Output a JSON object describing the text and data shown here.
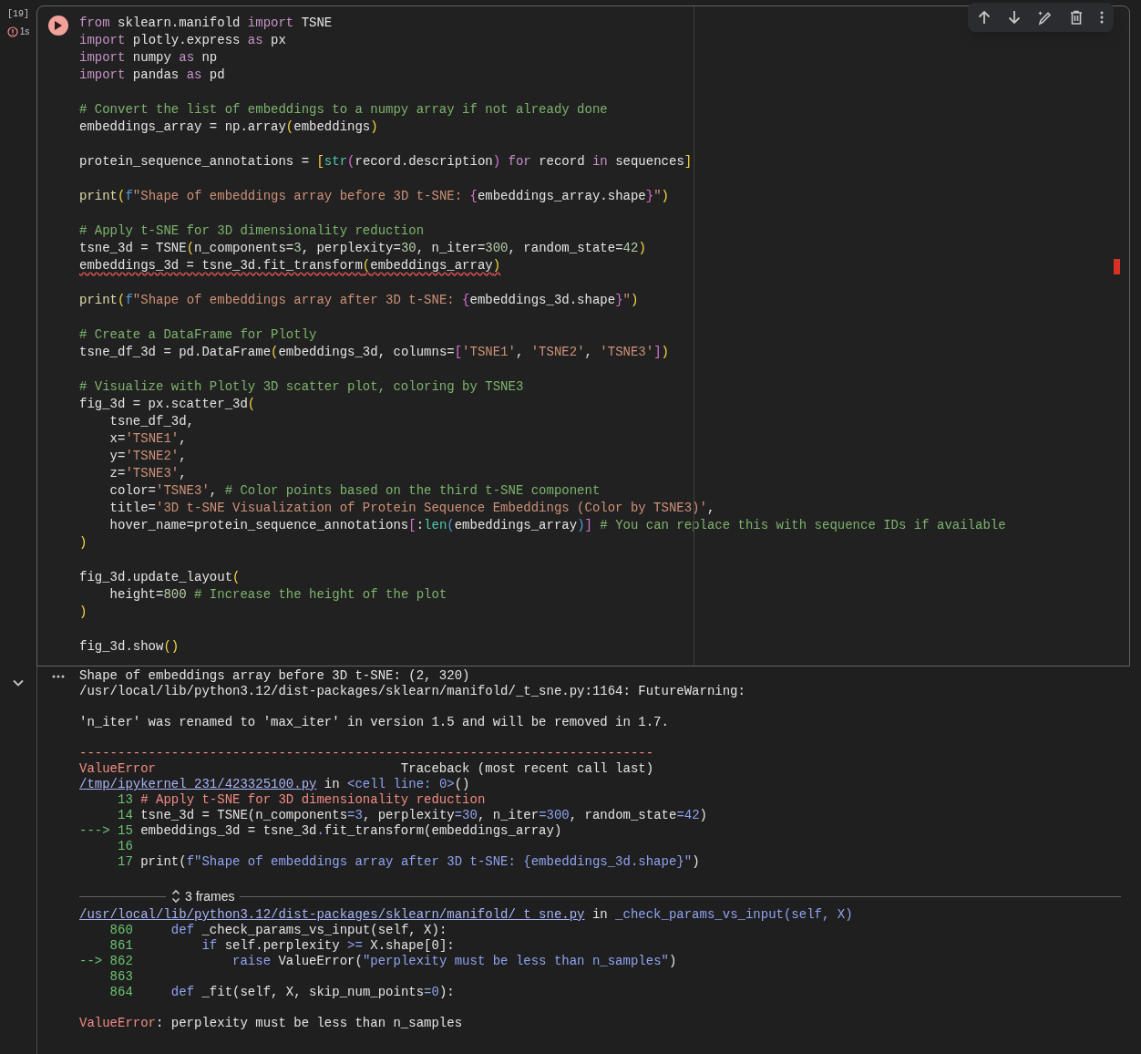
{
  "cell": {
    "execution_count": "[19]",
    "duration": "1s",
    "has_error": true,
    "selected": true
  },
  "code_blocks": [
    [
      {
        "tokens": [
          {
            "kind": "keyword",
            "text": "from"
          },
          {
            "kind": "plain",
            "text": " sklearn.manifold "
          },
          {
            "kind": "keyword",
            "text": "import"
          },
          {
            "kind": "plain",
            "text": " TSNE"
          }
        ]
      },
      {
        "tokens": [
          {
            "kind": "keyword",
            "text": "import"
          },
          {
            "kind": "plain",
            "text": " plotly.express "
          },
          {
            "kind": "keyword",
            "text": "as"
          },
          {
            "kind": "plain",
            "text": " px"
          }
        ]
      },
      {
        "tokens": [
          {
            "kind": "keyword",
            "text": "import"
          },
          {
            "kind": "plain",
            "text": " numpy "
          },
          {
            "kind": "keyword",
            "text": "as"
          },
          {
            "kind": "plain",
            "text": " np"
          }
        ]
      },
      {
        "tokens": [
          {
            "kind": "keyword",
            "text": "import"
          },
          {
            "kind": "plain",
            "text": " pandas "
          },
          {
            "kind": "keyword",
            "text": "as"
          },
          {
            "kind": "plain",
            "text": " pd"
          }
        ]
      }
    ],
    [
      {
        "tokens": [
          {
            "kind": "comment",
            "text": "# Convert the list of embeddings to a numpy array if not already done"
          }
        ]
      },
      {
        "tokens": [
          {
            "kind": "plain",
            "text": "embeddings_array = np.array"
          },
          {
            "kind": "bracket",
            "text": "("
          },
          {
            "kind": "plain",
            "text": "embeddings"
          },
          {
            "kind": "bracket",
            "text": ")"
          }
        ]
      }
    ],
    [
      {
        "tokens": [
          {
            "kind": "plain",
            "text": "protein_sequence_annotations = "
          },
          {
            "kind": "bracket",
            "text": "["
          },
          {
            "kind": "builtin",
            "text": "str"
          },
          {
            "kind": "bracket2",
            "text": "("
          },
          {
            "kind": "plain",
            "text": "record.description"
          },
          {
            "kind": "bracket2",
            "text": ")"
          },
          {
            "kind": "keyword",
            "text": " for"
          },
          {
            "kind": "plain",
            "text": " record "
          },
          {
            "kind": "keyword",
            "text": "in"
          },
          {
            "kind": "plain",
            "text": " sequences"
          },
          {
            "kind": "bracket",
            "text": "]"
          }
        ]
      }
    ],
    [
      {
        "tokens": [
          {
            "kind": "function",
            "text": "print"
          },
          {
            "kind": "bracket",
            "text": "("
          },
          {
            "kind": "prefix",
            "text": "f"
          },
          {
            "kind": "string",
            "text": "\"Shape of embeddings array before 3D t-SNE: "
          },
          {
            "kind": "bracket2",
            "text": "{"
          },
          {
            "kind": "plain",
            "text": "embeddings_array.shape"
          },
          {
            "kind": "bracket2",
            "text": "}"
          },
          {
            "kind": "string",
            "text": "\""
          },
          {
            "kind": "bracket",
            "text": ")"
          }
        ]
      }
    ],
    [
      {
        "tokens": [
          {
            "kind": "comment",
            "text": "# Apply t-SNE for 3D dimensionality reduction"
          }
        ]
      },
      {
        "tokens": [
          {
            "kind": "plain",
            "text": "tsne_3d = TSNE"
          },
          {
            "kind": "bracket",
            "text": "("
          },
          {
            "kind": "plain",
            "text": "n_components="
          },
          {
            "kind": "number",
            "text": "3"
          },
          {
            "kind": "plain",
            "text": ", perplexity="
          },
          {
            "kind": "number",
            "text": "30"
          },
          {
            "kind": "plain",
            "text": ", n_iter="
          },
          {
            "kind": "number",
            "text": "300"
          },
          {
            "kind": "plain",
            "text": ", random_state="
          },
          {
            "kind": "number",
            "text": "42"
          },
          {
            "kind": "bracket",
            "text": ")"
          }
        ]
      },
      {
        "tokens": [
          {
            "kind": "plain",
            "text": "embeddings_3d = tsne_3d.fit_transform"
          },
          {
            "kind": "bracket",
            "text": "("
          },
          {
            "kind": "plain",
            "text": "embeddings_array"
          },
          {
            "kind": "bracket",
            "text": ")"
          }
        ],
        "error_underline": true
      }
    ],
    [
      {
        "tokens": [
          {
            "kind": "function",
            "text": "print"
          },
          {
            "kind": "bracket",
            "text": "("
          },
          {
            "kind": "prefix",
            "text": "f"
          },
          {
            "kind": "string",
            "text": "\"Shape of embeddings array after 3D t-SNE: "
          },
          {
            "kind": "bracket2",
            "text": "{"
          },
          {
            "kind": "plain",
            "text": "embeddings_3d.shape"
          },
          {
            "kind": "bracket2",
            "text": "}"
          },
          {
            "kind": "string",
            "text": "\""
          },
          {
            "kind": "bracket",
            "text": ")"
          }
        ]
      }
    ],
    [
      {
        "tokens": [
          {
            "kind": "comment",
            "text": "# Create a DataFrame for Plotly"
          }
        ]
      },
      {
        "tokens": [
          {
            "kind": "plain",
            "text": "tsne_df_3d = pd.DataFrame"
          },
          {
            "kind": "bracket",
            "text": "("
          },
          {
            "kind": "plain",
            "text": "embeddings_3d, columns="
          },
          {
            "kind": "bracket2",
            "text": "["
          },
          {
            "kind": "string",
            "text": "'TSNE1'"
          },
          {
            "kind": "plain",
            "text": ", "
          },
          {
            "kind": "string",
            "text": "'TSNE2'"
          },
          {
            "kind": "plain",
            "text": ", "
          },
          {
            "kind": "string",
            "text": "'TSNE3'"
          },
          {
            "kind": "bracket2",
            "text": "]"
          },
          {
            "kind": "bracket",
            "text": ")"
          }
        ]
      }
    ],
    [
      {
        "tokens": [
          {
            "kind": "comment",
            "text": "# Visualize with Plotly 3D scatter plot, coloring by TSNE3"
          }
        ]
      },
      {
        "tokens": [
          {
            "kind": "plain",
            "text": "fig_3d = px.scatter_3d"
          },
          {
            "kind": "bracket",
            "text": "("
          }
        ]
      },
      {
        "tokens": [
          {
            "kind": "plain",
            "text": "    tsne_df_3d,"
          }
        ]
      },
      {
        "tokens": [
          {
            "kind": "plain",
            "text": "    x="
          },
          {
            "kind": "string",
            "text": "'TSNE1'"
          },
          {
            "kind": "plain",
            "text": ","
          }
        ]
      },
      {
        "tokens": [
          {
            "kind": "plain",
            "text": "    y="
          },
          {
            "kind": "string",
            "text": "'TSNE2'"
          },
          {
            "kind": "plain",
            "text": ","
          }
        ]
      },
      {
        "tokens": [
          {
            "kind": "plain",
            "text": "    z="
          },
          {
            "kind": "string",
            "text": "'TSNE3'"
          },
          {
            "kind": "plain",
            "text": ","
          }
        ]
      },
      {
        "tokens": [
          {
            "kind": "plain",
            "text": "    color="
          },
          {
            "kind": "string",
            "text": "'TSNE3'"
          },
          {
            "kind": "plain",
            "text": ", "
          },
          {
            "kind": "comment",
            "text": "# Color points based on the third t-SNE component"
          }
        ]
      },
      {
        "tokens": [
          {
            "kind": "plain",
            "text": "    title="
          },
          {
            "kind": "string",
            "text": "'3D t-SNE Visualization of Protein Sequence Embeddings (Color by TSNE3)'"
          },
          {
            "kind": "plain",
            "text": ","
          }
        ]
      },
      {
        "tokens": [
          {
            "kind": "plain",
            "text": "    hover_name=protein_sequence_annotations"
          },
          {
            "kind": "bracket2",
            "text": "["
          },
          {
            "kind": "plain",
            "text": ":"
          },
          {
            "kind": "builtin",
            "text": "len"
          },
          {
            "kind": "bracket3",
            "text": "("
          },
          {
            "kind": "plain",
            "text": "embeddings_array"
          },
          {
            "kind": "bracket3",
            "text": ")"
          },
          {
            "kind": "bracket2",
            "text": "]"
          },
          {
            "kind": "comment",
            "text": " # You can replace this with sequence IDs if available"
          }
        ]
      },
      {
        "tokens": [
          {
            "kind": "bracket",
            "text": ")"
          }
        ]
      }
    ],
    [
      {
        "tokens": [
          {
            "kind": "plain",
            "text": "fig_3d.update_layout"
          },
          {
            "kind": "bracket",
            "text": "("
          }
        ]
      },
      {
        "tokens": [
          {
            "kind": "plain",
            "text": "    height="
          },
          {
            "kind": "number",
            "text": "800"
          },
          {
            "kind": "comment",
            "text": " # Increase the height of the plot"
          }
        ]
      },
      {
        "tokens": [
          {
            "kind": "bracket",
            "text": ")"
          }
        ]
      }
    ],
    [
      {
        "tokens": [
          {
            "kind": "plain",
            "text": "fig_3d.show"
          },
          {
            "kind": "bracket",
            "text": "()"
          }
        ]
      }
    ]
  ],
  "output": {
    "expanded": true,
    "blocks_before_frames": [
      [
        [
          {
            "kind": "plain",
            "text": "Shape of embeddings array before 3D t-SNE: (2, 320)"
          }
        ],
        [
          {
            "kind": "plain",
            "text": "/usr/local/lib/python3.12/dist-packages/sklearn/manifold/_t_sne.py:1164: FutureWarning:"
          }
        ]
      ],
      [
        [
          {
            "kind": "plain",
            "text": "'n_iter' was renamed to 'max_iter' in version 1.5 and will be removed in 1.7."
          }
        ]
      ],
      [
        [
          {
            "kind": "error",
            "text": "---------------------------------------------------------------------------"
          }
        ],
        [
          {
            "kind": "error",
            "text": "ValueError"
          },
          {
            "kind": "plain",
            "text": "                                Traceback (most recent call last)"
          }
        ],
        [
          {
            "kind": "link",
            "text": "/tmp/ipykernel_231/423325100.py"
          },
          {
            "kind": "plain",
            "text": " in "
          },
          {
            "kind": "accent",
            "text": "<cell line: 0>"
          },
          {
            "kind": "plain",
            "text": "()"
          }
        ],
        [
          {
            "kind": "lineno",
            "text": "     13 "
          },
          {
            "kind": "error",
            "text": "# Apply t-SNE for 3D dimensionality reduction"
          }
        ],
        [
          {
            "kind": "lineno",
            "text": "     14 "
          },
          {
            "kind": "plain",
            "text": "tsne_3d = TSNE(n_components"
          },
          {
            "kind": "accent",
            "text": "=3"
          },
          {
            "kind": "plain",
            "text": ", perplexity"
          },
          {
            "kind": "accent",
            "text": "=30"
          },
          {
            "kind": "plain",
            "text": ", n_iter"
          },
          {
            "kind": "accent",
            "text": "=300"
          },
          {
            "kind": "plain",
            "text": ", random_state"
          },
          {
            "kind": "accent",
            "text": "=42"
          },
          {
            "kind": "plain",
            "text": ")"
          }
        ],
        [
          {
            "kind": "lineno",
            "text": "---> 15 "
          },
          {
            "kind": "plain",
            "text": "embeddings_3d = tsne_3d"
          },
          {
            "kind": "accent",
            "text": "."
          },
          {
            "kind": "plain",
            "text": "fit_transform(embeddings_array)"
          }
        ],
        [
          {
            "kind": "lineno",
            "text": "     16"
          }
        ],
        [
          {
            "kind": "lineno",
            "text": "     17 "
          },
          {
            "kind": "plain",
            "text": "print("
          },
          {
            "kind": "accent",
            "text": "f\"Shape of embeddings array after 3D t-SNE: {embeddings_3d.shape}\""
          },
          {
            "kind": "plain",
            "text": ")"
          }
        ]
      ]
    ],
    "frames_toggle": {
      "label": "3 frames"
    },
    "blocks_after_frames": [
      [
        [
          {
            "kind": "link",
            "text": "/usr/local/lib/python3.12/dist-packages/sklearn/manifold/_t_sne.py"
          },
          {
            "kind": "plain",
            "text": " in "
          },
          {
            "kind": "accent",
            "text": "_check_params_vs_input(self, X)"
          }
        ],
        [
          {
            "kind": "lineno",
            "text": "    860     "
          },
          {
            "kind": "accent",
            "text": "def"
          },
          {
            "kind": "plain",
            "text": " _check_params_vs_input(self, X):"
          }
        ],
        [
          {
            "kind": "lineno",
            "text": "    861         "
          },
          {
            "kind": "accent",
            "text": "if"
          },
          {
            "kind": "plain",
            "text": " self.perplexity "
          },
          {
            "kind": "accent",
            "text": ">="
          },
          {
            "kind": "plain",
            "text": " X.shape[0]:"
          }
        ],
        [
          {
            "kind": "lineno",
            "text": "--> 862             "
          },
          {
            "kind": "accent",
            "text": "raise"
          },
          {
            "kind": "plain",
            "text": " ValueError("
          },
          {
            "kind": "accent",
            "text": "\"perplexity must be less than n_samples\""
          },
          {
            "kind": "plain",
            "text": ")"
          }
        ],
        [
          {
            "kind": "lineno",
            "text": "    863"
          }
        ],
        [
          {
            "kind": "lineno",
            "text": "    864     "
          },
          {
            "kind": "accent",
            "text": "def"
          },
          {
            "kind": "plain",
            "text": " _fit(self, X, skip_num_points"
          },
          {
            "kind": "accent",
            "text": "=0"
          },
          {
            "kind": "plain",
            "text": "):"
          }
        ]
      ],
      [
        [
          {
            "kind": "error",
            "text": "ValueError"
          },
          {
            "kind": "plain",
            "text": ": perplexity must be less than n_samples"
          }
        ]
      ]
    ]
  }
}
